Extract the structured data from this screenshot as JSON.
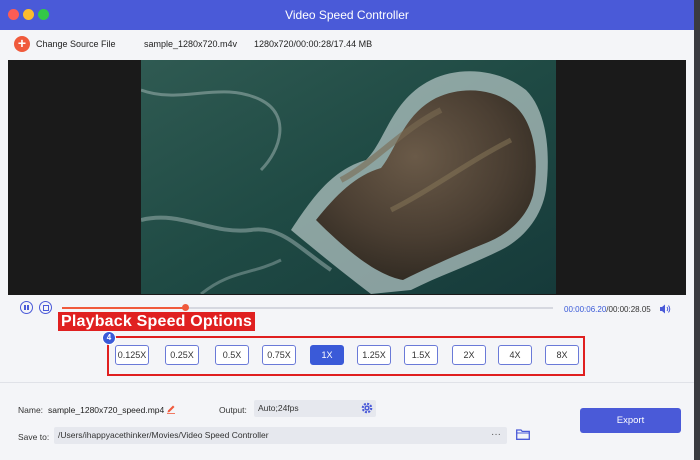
{
  "window": {
    "title": "Video Speed Controller"
  },
  "source": {
    "change_label": "Change Source File",
    "filename": "sample_1280x720.m4v",
    "info": "1280x720/00:00:28/17.44 MB"
  },
  "player": {
    "current_time": "00:00:06.20",
    "total_time": "/00:00:28.05",
    "progress": 0.25
  },
  "annotation": {
    "callout": "Playback Speed Options",
    "badge": "4"
  },
  "speeds": {
    "options": [
      "0.125X",
      "0.25X",
      "0.5X",
      "0.75X",
      "1X",
      "1.25X",
      "1.5X",
      "2X",
      "4X",
      "8X"
    ],
    "selected": "1X"
  },
  "output_panel": {
    "name_label": "Name:",
    "name_value": "sample_1280x720_speed.mp4",
    "output_label": "Output:",
    "output_value": "Auto;24fps",
    "save_label": "Save to:",
    "save_path": "/Users/ihappyacethinker/Movies/Video Speed Controller",
    "browse": "···",
    "export_label": "Export"
  },
  "colors": {
    "accent": "#4a5ad8",
    "highlight": "#e02020",
    "progress": "#f05a3c"
  }
}
